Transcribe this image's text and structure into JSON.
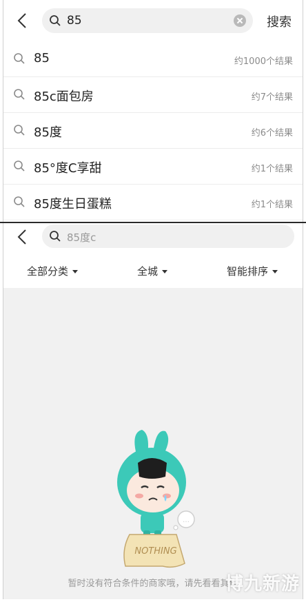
{
  "top": {
    "search_value": "85",
    "search_button": "搜索",
    "suggestions": [
      {
        "text": "85",
        "count": "约1000个结果"
      },
      {
        "text": "85c面包房",
        "count": "约7个结果"
      },
      {
        "text": "85度",
        "count": "约6个结果"
      },
      {
        "text": "85°度C享甜",
        "count": "约1个结果"
      },
      {
        "text": "85度生日蛋糕",
        "count": "约1个结果"
      }
    ]
  },
  "bottom": {
    "search_value": "85度c",
    "filters": [
      {
        "label": "全部分类"
      },
      {
        "label": "全城"
      },
      {
        "label": "智能排序"
      }
    ],
    "empty_sign": "NOTHING",
    "empty_message": "暂时没有符合条件的商家哦，请先看看其他"
  },
  "watermark": "博九新游",
  "colors": {
    "mascot": "#3cc9b8",
    "background_empty": "#f1f1f1",
    "search_fill": "#f0f0f0"
  }
}
